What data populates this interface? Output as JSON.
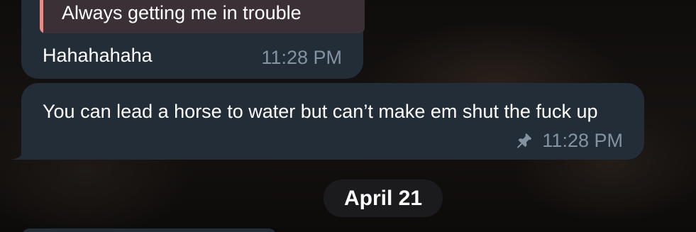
{
  "chat": {
    "messages": [
      {
        "reply_quote": "Always getting me in trouble",
        "text": "Hahahahaha",
        "time": "11:28 PM",
        "pinned": false
      },
      {
        "text": "You can lead a horse to water but can’t make em shut the fuck up",
        "time": "11:28 PM",
        "pinned": true
      }
    ],
    "date_separator": "April 21"
  },
  "colors": {
    "bubble": "#222d38",
    "reply_accent": "#e58d84",
    "timestamp": "#8493a2",
    "date_pill": "#1b1b1d"
  },
  "icons": {
    "pin": "pin-icon"
  }
}
